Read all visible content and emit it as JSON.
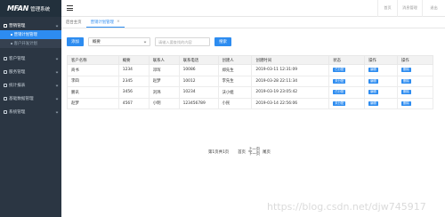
{
  "brand": {
    "logo": "MFAN",
    "subtitle": "管理系统"
  },
  "sidebar": {
    "groups": [
      {
        "label": "营销管理",
        "active": true,
        "subitems": [
          {
            "label": "营销计划管理",
            "current": true
          },
          {
            "label": "客户开发计划",
            "current": false
          }
        ]
      },
      {
        "label": "客户管理",
        "active": false
      },
      {
        "label": "服务管理",
        "active": false
      },
      {
        "label": "统计报表",
        "active": false
      },
      {
        "label": "基础数据管理",
        "active": false
      },
      {
        "label": "系统管理",
        "active": false
      }
    ]
  },
  "topbar": {
    "menu_icon": "hamburger-icon",
    "actions": [
      "首页",
      "消息管理",
      "退出"
    ]
  },
  "tabs": {
    "items": [
      {
        "label": "后台主页"
      },
      {
        "label": "营销计划管理",
        "close": "×"
      }
    ]
  },
  "toolbar": {
    "add_label": "添加",
    "select_value": "概要",
    "search_placeholder": "请输入要查找的内容",
    "search_label": "搜索"
  },
  "table": {
    "columns": [
      "客户名称",
      "概要",
      "联系人",
      "联系电话",
      "创建人",
      "创建时间",
      "状态",
      "操作",
      "操作"
    ],
    "rows": [
      [
        "商书",
        "1234",
        "邓珲",
        "10086",
        "郑先生",
        "2019-03-11 12:31:09",
        "已分配",
        "编辑",
        "删除"
      ],
      [
        "李四",
        "2345",
        "赵梦",
        "10012",
        "李先生",
        "2019-03-28 22:11:34",
        "未分配",
        "编辑",
        "删除"
      ],
      [
        "鹏讯",
        "3456",
        "刘玮",
        "10234",
        "沃小姐",
        "2019-03-19 23:05:42",
        "已分配",
        "编辑",
        "删除"
      ],
      [
        "赵梦",
        "4567",
        "小明",
        "123456789",
        "小民",
        "2019-03-14 22:56:06",
        "未分配",
        "编辑",
        "删除"
      ]
    ]
  },
  "pager": {
    "info": "第1页共1页",
    "first": "首页",
    "prev": "上一页",
    "next": "下一页",
    "last": "尾页"
  },
  "watermark": "https://blog.csdn.net/djw745917",
  "colors": {
    "sidebar_bg": "#2b3643",
    "accent": "#2d8cf0",
    "header_bg": "#f2f2f2"
  }
}
